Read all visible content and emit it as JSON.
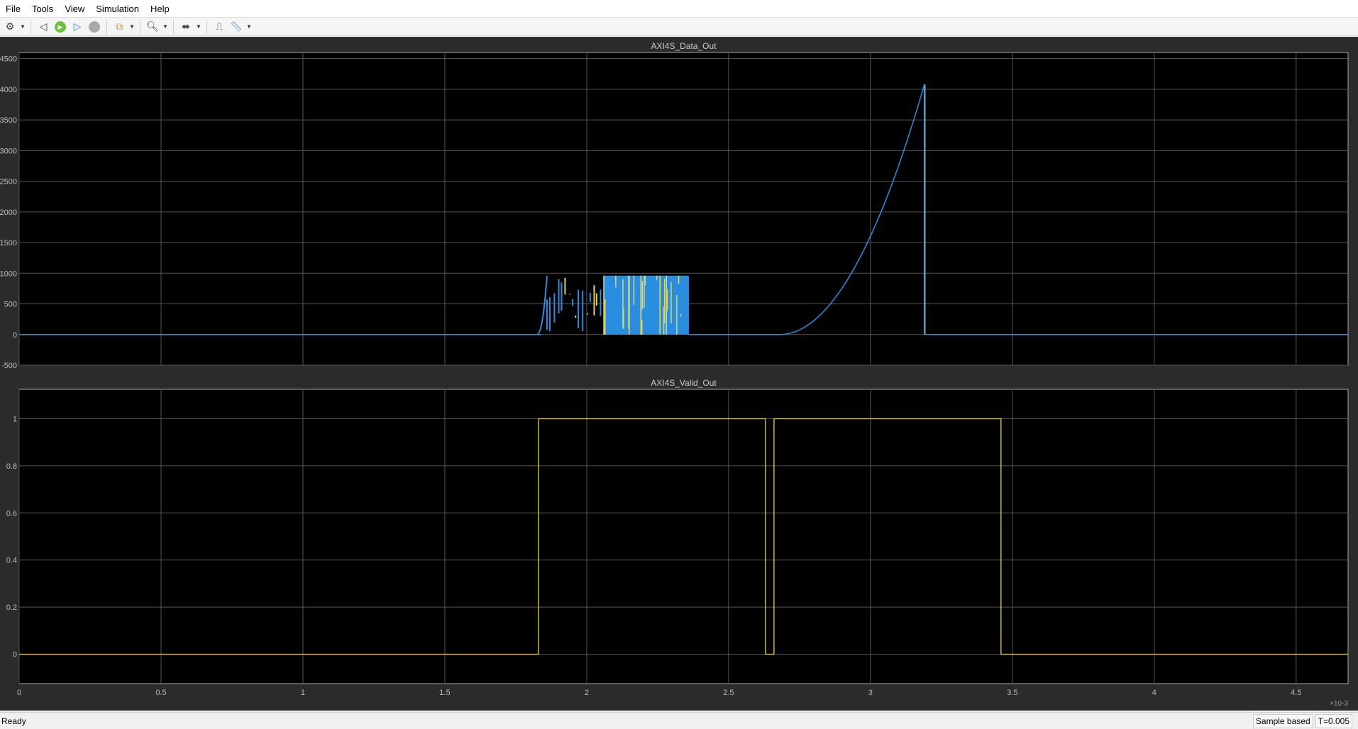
{
  "menu": [
    "File",
    "Tools",
    "View",
    "Simulation",
    "Help"
  ],
  "status": {
    "left": "Ready",
    "mode": "Sample based",
    "time": "T=0.005"
  },
  "chart_data": [
    {
      "type": "line",
      "title": "AXI4S_Data_Out",
      "xlim": [
        0,
        4.683
      ],
      "ylim": [
        -500,
        4600
      ],
      "yticks": [
        "-500",
        "0",
        "500",
        "1000",
        "1500",
        "2000",
        "2500",
        "3000",
        "3500",
        "4000",
        "4500"
      ],
      "xticks": [
        "0",
        "0.5",
        "1",
        "1.5",
        "2",
        "2.5",
        "3",
        "3.5",
        "4",
        "4.5"
      ],
      "x_multiplier": "×10-3",
      "series": [
        {
          "name": "data",
          "color": "#2a8ee0",
          "segments": [
            {
              "kind": "flat",
              "x": [
                0,
                1.84
              ],
              "y": 0
            },
            {
              "kind": "burst",
              "x": [
                1.84,
                2.36
              ],
              "y": [
                0,
                960
              ]
            },
            {
              "kind": "flat",
              "x": [
                2.36,
                2.68
              ],
              "y": 0
            },
            {
              "kind": "quadratic_rise",
              "x": [
                2.68,
                3.19
              ],
              "y": [
                0,
                4080
              ]
            },
            {
              "kind": "flat",
              "x": [
                3.19,
                4.683
              ],
              "y": 0
            }
          ]
        }
      ]
    },
    {
      "type": "line",
      "title": "AXI4S_Valid_Out",
      "xlim": [
        0,
        4.683
      ],
      "ylim": [
        -0.125,
        1.125
      ],
      "yticks": [
        "0",
        "0.2",
        "0.4",
        "0.6",
        "0.8",
        "1"
      ],
      "xticks": [
        "0",
        "0.5",
        "1",
        "1.5",
        "2",
        "2.5",
        "3",
        "3.5",
        "4",
        "4.5"
      ],
      "x_multiplier": "×10-3",
      "series": [
        {
          "name": "valid",
          "color": "#e8d44d",
          "x": [
            0,
            1.83,
            1.83,
            2.63,
            2.63,
            2.66,
            2.66,
            3.46,
            3.46,
            4.683
          ],
          "y": [
            0,
            0,
            1,
            1,
            0,
            0,
            1,
            1,
            0,
            0
          ]
        }
      ]
    }
  ]
}
